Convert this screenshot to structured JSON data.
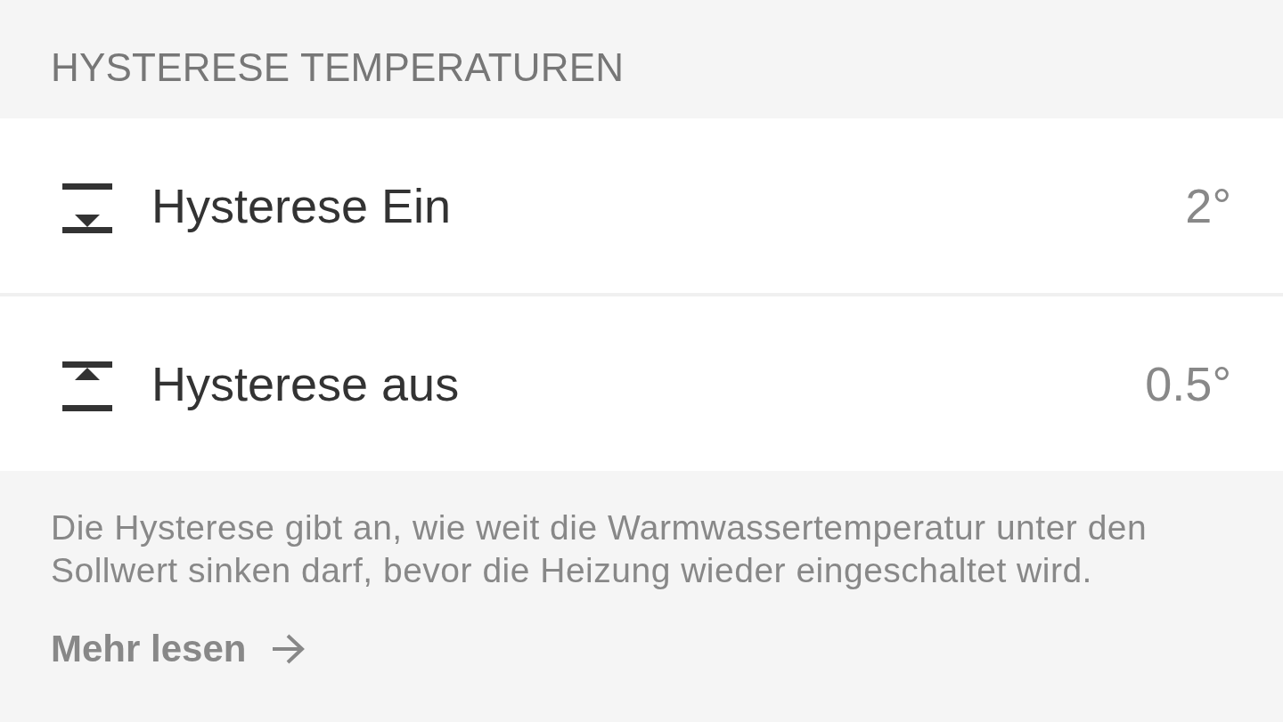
{
  "section_header": "HYSTERESE TEMPERATUREN",
  "settings": [
    {
      "kind": "lower",
      "label": "Hysterese Ein",
      "value": "2°"
    },
    {
      "kind": "upper",
      "label": "Hysterese aus",
      "value": "0.5°"
    }
  ],
  "footer": {
    "description": "Die Hysterese gibt an, wie weit die Warmwassertemperatur unter den Sollwert sinken darf, bevor die Heizung wieder eingeschaltet wird.",
    "link": "Mehr lesen"
  }
}
